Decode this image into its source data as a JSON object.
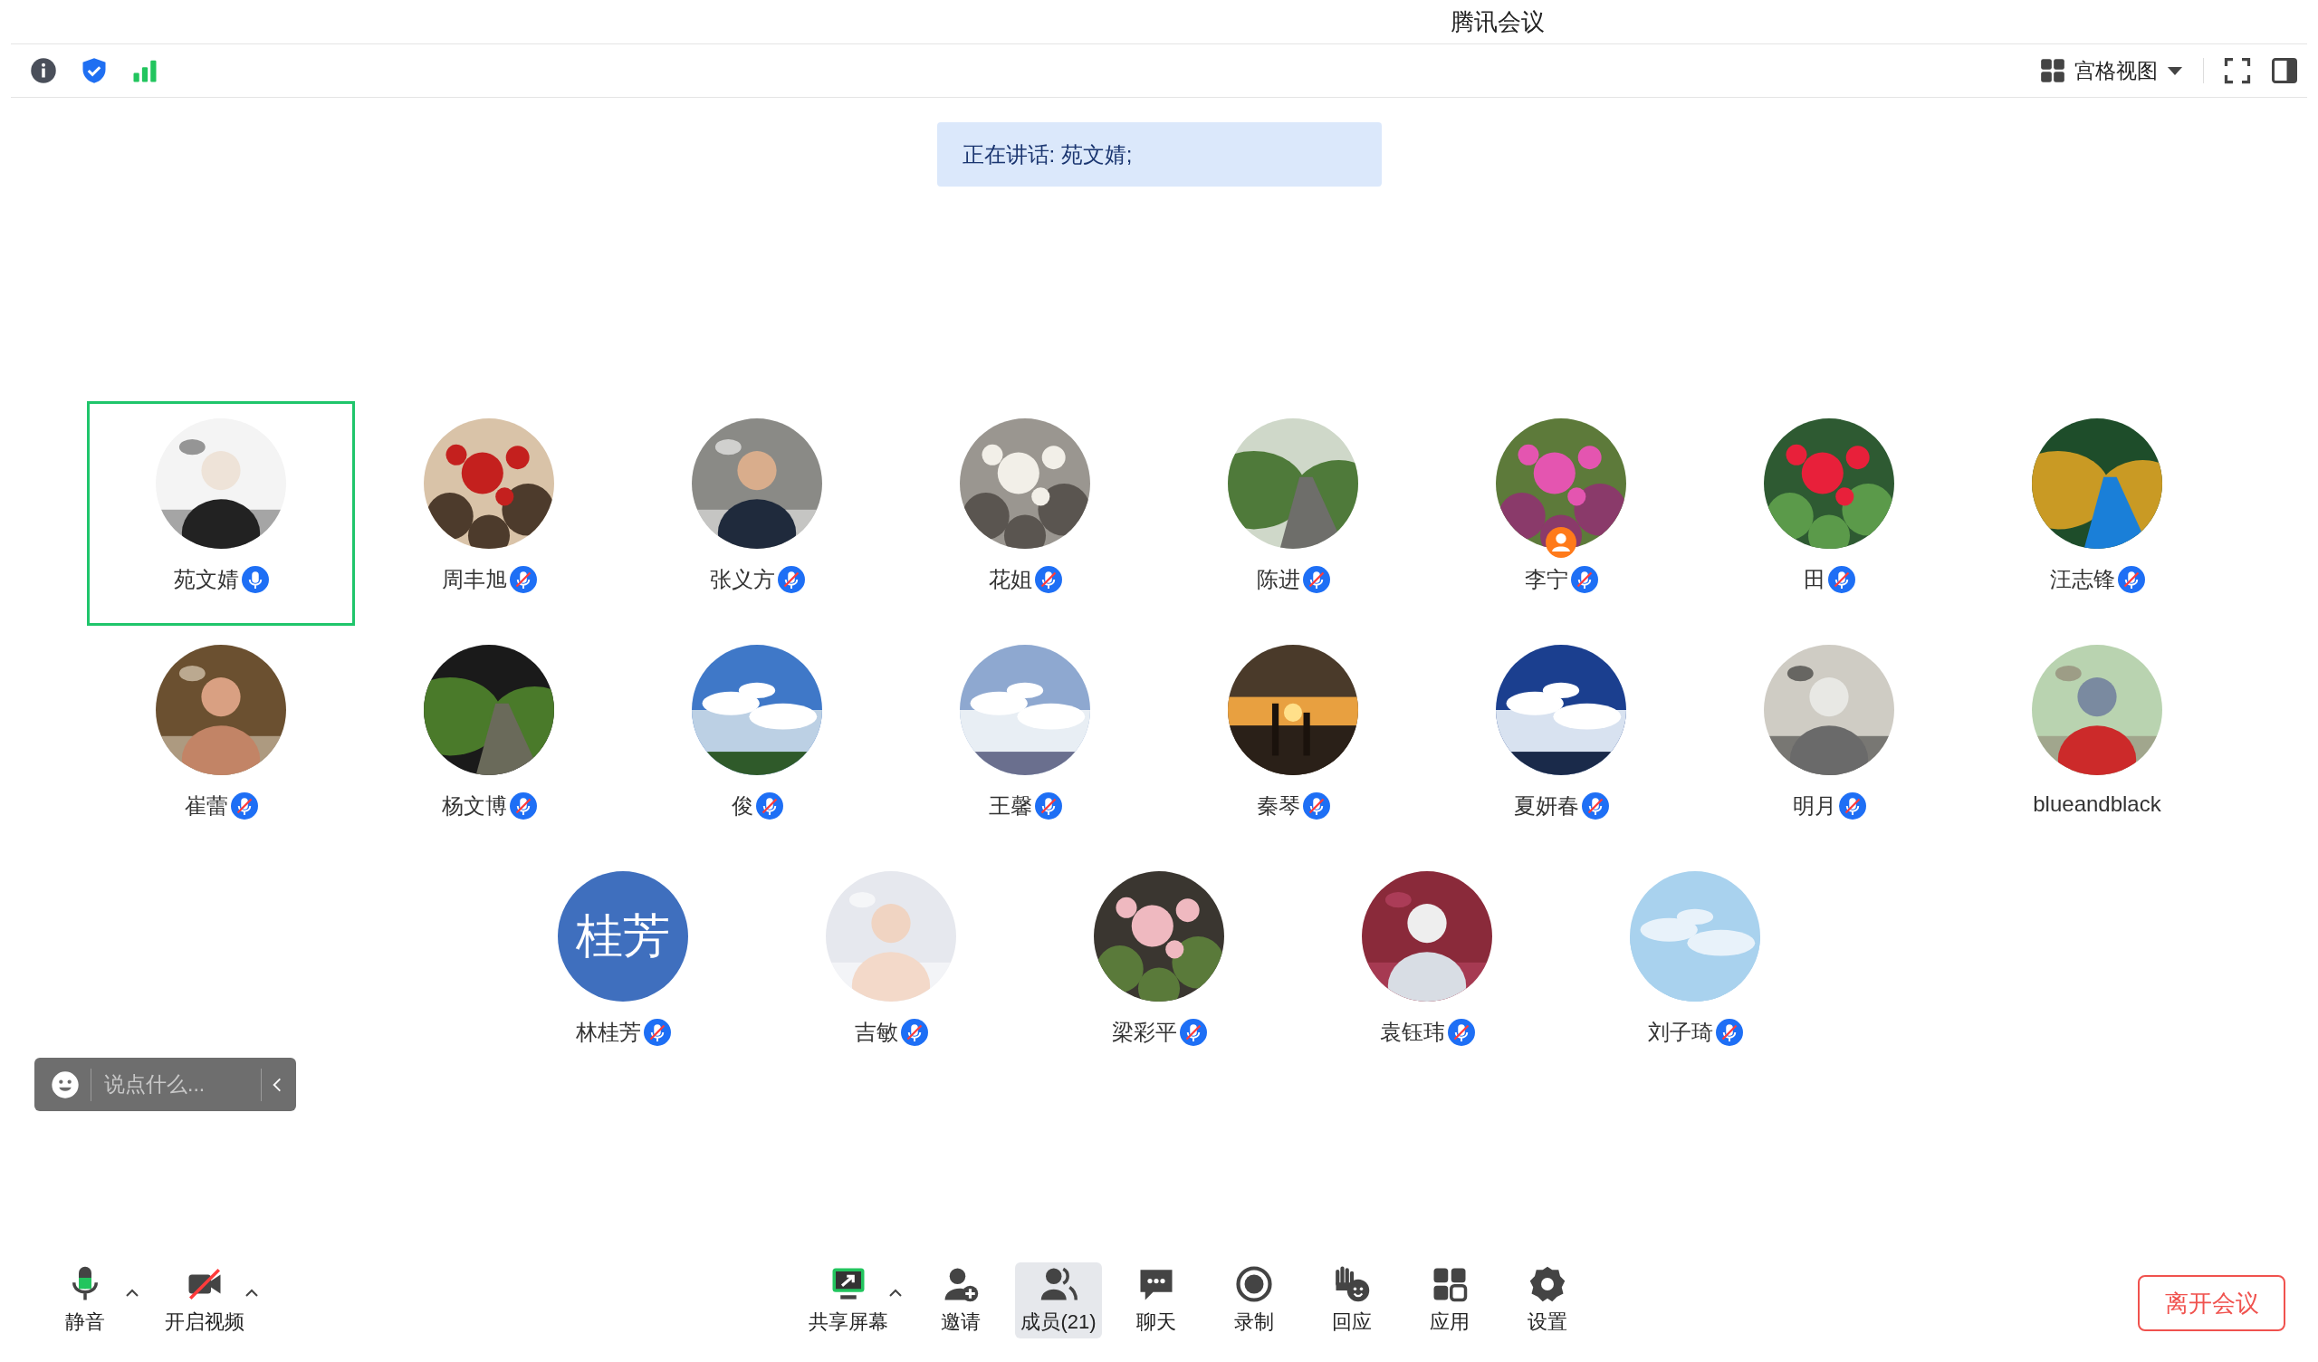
{
  "window": {
    "title": "腾讯会议"
  },
  "toolbar": {
    "view_mode": "宫格视图"
  },
  "speaking_banner": "正在讲话: 苑文婧;",
  "participants": [
    {
      "name": "苑文婧",
      "kind": "picture",
      "mic": {
        "muted": false
      },
      "selected": true,
      "host": false
    },
    {
      "name": "周丰旭",
      "kind": "picture",
      "mic": {
        "muted": true
      },
      "selected": false,
      "host": false
    },
    {
      "name": "张义方",
      "kind": "picture",
      "mic": {
        "muted": true
      },
      "selected": false,
      "host": false
    },
    {
      "name": "花姐",
      "kind": "picture",
      "mic": {
        "muted": true
      },
      "selected": false,
      "host": false
    },
    {
      "name": "陈进",
      "kind": "picture",
      "mic": {
        "muted": true
      },
      "selected": false,
      "host": false
    },
    {
      "name": "李宁",
      "kind": "picture",
      "mic": {
        "muted": true
      },
      "selected": false,
      "host": true
    },
    {
      "name": "田",
      "kind": "picture",
      "mic": {
        "muted": true
      },
      "selected": false,
      "host": false
    },
    {
      "name": "汪志锋",
      "kind": "picture",
      "mic": {
        "muted": true
      },
      "selected": false,
      "host": false
    },
    {
      "name": "崔蕾",
      "kind": "picture",
      "mic": {
        "muted": true
      },
      "selected": false,
      "host": false
    },
    {
      "name": "杨文博",
      "kind": "picture",
      "mic": {
        "muted": true
      },
      "selected": false,
      "host": false
    },
    {
      "name": "俊",
      "kind": "picture",
      "mic": {
        "muted": true
      },
      "selected": false,
      "host": false
    },
    {
      "name": "王馨",
      "kind": "picture",
      "mic": {
        "muted": true
      },
      "selected": false,
      "host": false
    },
    {
      "name": "秦琴",
      "kind": "picture",
      "mic": {
        "muted": true
      },
      "selected": false,
      "host": false
    },
    {
      "name": "夏妍春",
      "kind": "picture",
      "mic": {
        "muted": true
      },
      "selected": false,
      "host": false
    },
    {
      "name": "明月",
      "kind": "picture",
      "mic": {
        "muted": true
      },
      "selected": false,
      "host": false
    },
    {
      "name": "blueandblack",
      "kind": "picture",
      "selected": false,
      "host": false
    },
    {
      "name": "林桂芳",
      "kind": "initials",
      "initials": "桂芳",
      "mic": {
        "muted": true
      },
      "selected": false,
      "host": false
    },
    {
      "name": "吉敏",
      "kind": "picture",
      "mic": {
        "muted": true
      },
      "selected": false,
      "host": false
    },
    {
      "name": "梁彩平",
      "kind": "picture",
      "mic": {
        "muted": true
      },
      "selected": false,
      "host": false
    },
    {
      "name": "袁钰玮",
      "kind": "picture",
      "mic": {
        "muted": true
      },
      "selected": false,
      "host": false
    },
    {
      "name": "刘子琦",
      "kind": "picture",
      "mic": {
        "muted": true
      },
      "selected": false,
      "host": false
    }
  ],
  "chat_input": {
    "placeholder": "说点什么..."
  },
  "controls": [
    {
      "label": "静音",
      "caret": true,
      "selected": false
    },
    {
      "label": "开启视频",
      "caret": true,
      "selected": false
    },
    {
      "label": "共享屏幕",
      "caret": true,
      "selected": false
    },
    {
      "label": "邀请",
      "caret": false,
      "selected": false
    },
    {
      "label": "成员(21)",
      "caret": false,
      "selected": true
    },
    {
      "label": "聊天",
      "caret": false,
      "selected": false
    },
    {
      "label": "录制",
      "caret": false,
      "selected": false
    },
    {
      "label": "回应",
      "caret": false,
      "selected": false
    },
    {
      "label": "应用",
      "caret": false,
      "selected": false
    },
    {
      "label": "设置",
      "caret": false,
      "selected": false
    }
  ],
  "leave_button": "离开会议"
}
